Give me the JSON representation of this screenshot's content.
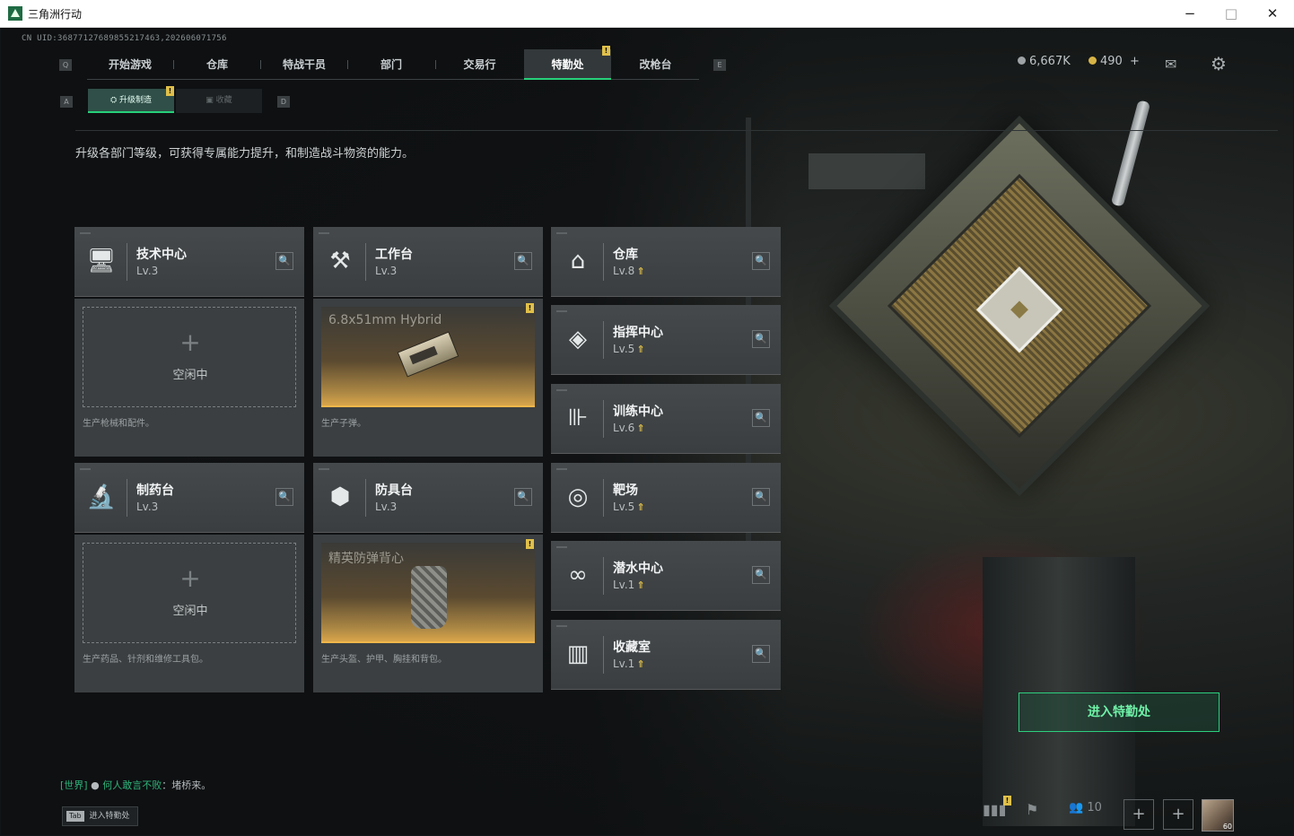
{
  "window": {
    "title": "三角洲行动",
    "minimize": "−",
    "maximize": "□",
    "close": "✕"
  },
  "uid": "CN UID:36877127689855217463,202606071756",
  "topnav": {
    "key_left": "Q",
    "key_right": "E",
    "tabs": [
      {
        "label": "开始游戏"
      },
      {
        "label": "仓库"
      },
      {
        "label": "特战干员"
      },
      {
        "label": "部门"
      },
      {
        "label": "交易行"
      },
      {
        "label": "特勤处",
        "active": true
      },
      {
        "label": "改枪台"
      }
    ],
    "active_badge": "!"
  },
  "currency": {
    "silver": "6,667K",
    "gold": "490",
    "gold_add": "+"
  },
  "subnav": {
    "key_left": "A",
    "key_right": "D",
    "tabs": [
      {
        "label": "升级制造",
        "active": true
      },
      {
        "label": "收藏"
      }
    ],
    "badge": "!"
  },
  "description": "升级各部门等级，可获得专属能力提升，和制造战斗物资的能力。",
  "facilities": {
    "tech": {
      "name": "技术中心",
      "level": "Lv.3"
    },
    "workbench": {
      "name": "工作台",
      "level": "Lv.3"
    },
    "warehouse": {
      "name": "仓库",
      "level": "Lv.8"
    },
    "command": {
      "name": "指挥中心",
      "level": "Lv.5"
    },
    "training": {
      "name": "训练中心",
      "level": "Lv.6"
    },
    "pharmacy": {
      "name": "制药台",
      "level": "Lv.3"
    },
    "armor": {
      "name": "防具台",
      "level": "Lv.3"
    },
    "range": {
      "name": "靶场",
      "level": "Lv.5"
    },
    "diving": {
      "name": "潜水中心",
      "level": "Lv.1"
    },
    "collection": {
      "name": "收藏室",
      "level": "Lv.1"
    }
  },
  "slots": {
    "tech": {
      "status": "空闲中",
      "footer": "生产枪械和配件。"
    },
    "workbench": {
      "item": "6.8x51mm Hybrid",
      "footer": "生产子弹。",
      "badge": "!"
    },
    "pharmacy": {
      "status": "空闲中",
      "footer": "生产药品、针剂和维修工具包。"
    },
    "armor": {
      "item": "精英防弹背心",
      "footer": "生产头盔、护甲、胸挂和背包。",
      "badge": "!"
    }
  },
  "enter_button": "进入特勤处",
  "chat": {
    "channel": "[世界]",
    "sender": "何人敢言不败",
    "message": "：堵桥来。"
  },
  "tab_hint": {
    "key": "Tab",
    "label": "进入特勤处"
  },
  "bottom": {
    "friends_count": "10",
    "avatar_level": "60",
    "stats_badge": "!"
  },
  "colors": {
    "accent_green": "#27d07a",
    "badge_yellow": "#e0c04a",
    "slot_gold": "#d9a54a"
  }
}
